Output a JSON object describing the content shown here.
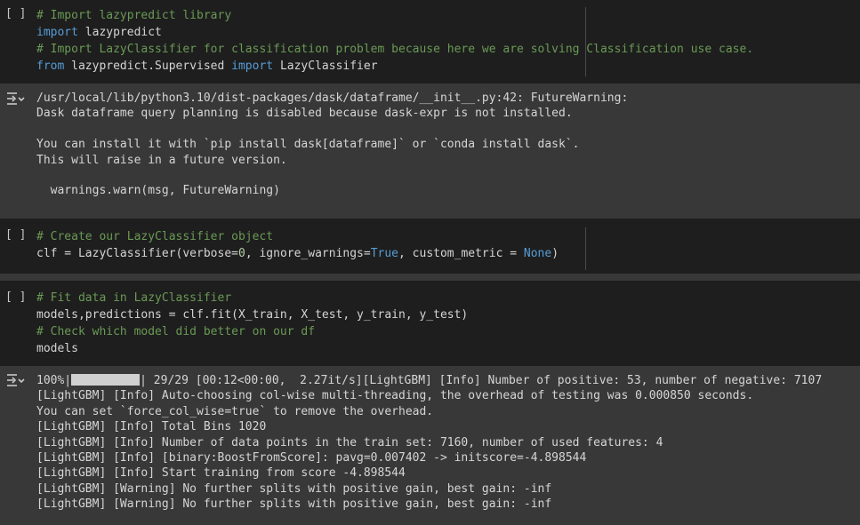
{
  "cells": {
    "c1": {
      "run_label": "[ ]",
      "code": [
        [
          {
            "t": "# Import lazypredict library",
            "c": "cm"
          }
        ],
        [
          {
            "t": "import",
            "c": "kw"
          },
          {
            "t": " lazypredict",
            "c": ""
          }
        ],
        [
          {
            "t": "# Import LazyClassifier for classification problem because here we are solving Classification use case.",
            "c": "cm"
          }
        ],
        [
          {
            "t": "from",
            "c": "kw"
          },
          {
            "t": " lazypredict.Supervised ",
            "c": ""
          },
          {
            "t": "import",
            "c": "kw"
          },
          {
            "t": " LazyClassifier",
            "c": ""
          }
        ]
      ]
    },
    "o1": {
      "icon": "output-toggle-icon",
      "lines": [
        "/usr/local/lib/python3.10/dist-packages/dask/dataframe/__init__.py:42: FutureWarning: ",
        "Dask dataframe query planning is disabled because dask-expr is not installed.",
        "",
        "You can install it with `pip install dask[dataframe]` or `conda install dask`.",
        "This will raise in a future version.",
        "",
        "  warnings.warn(msg, FutureWarning)"
      ]
    },
    "c2": {
      "run_label": "[ ]",
      "code": [
        [
          {
            "t": "# Create our LazyClassifier object",
            "c": "cm"
          }
        ],
        [
          {
            "t": "clf = LazyClassifier(verbose=",
            "c": ""
          },
          {
            "t": "0",
            "c": "nm"
          },
          {
            "t": ", ignore_warnings=",
            "c": ""
          },
          {
            "t": "True",
            "c": "bl"
          },
          {
            "t": ", custom_metric = ",
            "c": ""
          },
          {
            "t": "None",
            "c": "bl"
          },
          {
            "t": ")",
            "c": ""
          }
        ]
      ]
    },
    "c3": {
      "run_label": "[ ]",
      "code": [
        [
          {
            "t": "# Fit data in LazyClassifier",
            "c": "cm"
          }
        ],
        [
          {
            "t": "models,predictions = clf.fit(X_train, X_test, y_train, y_test)",
            "c": ""
          }
        ],
        [
          {
            "t": "# Check which model did better on our df",
            "c": "cm"
          }
        ],
        [
          {
            "t": "models",
            "c": ""
          }
        ]
      ]
    },
    "o2": {
      "icon": "output-toggle-icon",
      "progress": {
        "percent_label": "100%|",
        "fraction": 1.0,
        "tail": "| 29/29 [00:12<00:00,  2.27it/s][LightGBM] [Info] Number of positive: 53, number of negative: 7107"
      },
      "lines": [
        "[LightGBM] [Info] Auto-choosing col-wise multi-threading, the overhead of testing was 0.000850 seconds.",
        "You can set `force_col_wise=true` to remove the overhead.",
        "[LightGBM] [Info] Total Bins 1020",
        "[LightGBM] [Info] Number of data points in the train set: 7160, number of used features: 4",
        "[LightGBM] [Info] [binary:BoostFromScore]: pavg=0.007402 -> initscore=-4.898544",
        "[LightGBM] [Info] Start training from score -4.898544",
        "[LightGBM] [Warning] No further splits with positive gain, best gain: -inf",
        "[LightGBM] [Warning] No further splits with positive gain, best gain: -inf"
      ]
    }
  }
}
